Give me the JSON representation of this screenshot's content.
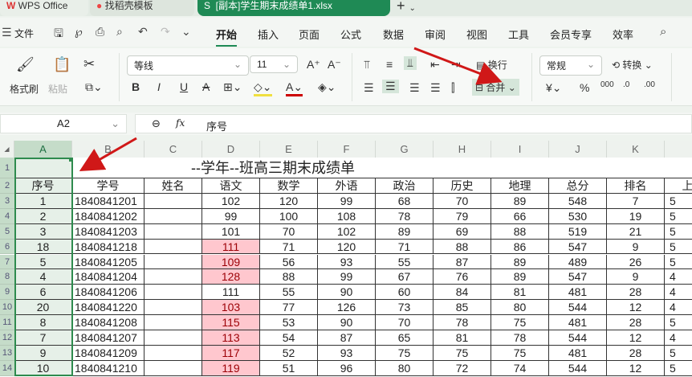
{
  "tabs": [
    {
      "label": "WPS Office"
    },
    {
      "label": "找稻壳模板"
    },
    {
      "label": "[副本]学生期末成绩单1.xlsx"
    }
  ],
  "menu": {
    "file": "文件",
    "items": [
      "开始",
      "插入",
      "页面",
      "公式",
      "数据",
      "审阅",
      "视图",
      "工具",
      "会员专享",
      "效率"
    ],
    "active": "开始"
  },
  "ribbon": {
    "format_painter": "格式刷",
    "paste": "粘贴",
    "font": "等线",
    "size": "11",
    "wrap": "换行",
    "merge": "合并",
    "number_format": "常规",
    "convert": "转换"
  },
  "formula": {
    "cell_ref": "A2",
    "value": "序号"
  },
  "columns": [
    "A",
    "B",
    "C",
    "D",
    "E",
    "F",
    "G",
    "H",
    "I",
    "J",
    "K"
  ],
  "rows": [
    "1",
    "2",
    "3",
    "4",
    "5",
    "6",
    "7",
    "8",
    "9",
    "10",
    "11",
    "12",
    "13",
    "14"
  ],
  "sheet": {
    "title": "--学年--班高三期末成绩单",
    "headers": [
      "序号",
      "学号",
      "姓名",
      "语文",
      "数学",
      "外语",
      "政治",
      "历史",
      "地理",
      "总分",
      "排名",
      "上次"
    ],
    "data": [
      [
        "1",
        "1840841201",
        "",
        "102",
        "120",
        "99",
        "68",
        "70",
        "89",
        "548",
        "7",
        "5"
      ],
      [
        "2",
        "1840841202",
        "",
        "99",
        "100",
        "108",
        "78",
        "79",
        "66",
        "530",
        "19",
        "5"
      ],
      [
        "3",
        "1840841203",
        "",
        "101",
        "70",
        "102",
        "89",
        "69",
        "88",
        "519",
        "21",
        "5"
      ],
      [
        "18",
        "1840841218",
        "",
        "111",
        "71",
        "120",
        "71",
        "88",
        "86",
        "547",
        "9",
        "5"
      ],
      [
        "5",
        "1840841205",
        "",
        "109",
        "56",
        "93",
        "55",
        "87",
        "89",
        "489",
        "26",
        "5"
      ],
      [
        "4",
        "1840841204",
        "",
        "128",
        "88",
        "99",
        "67",
        "76",
        "89",
        "547",
        "9",
        "4"
      ],
      [
        "6",
        "1840841206",
        "",
        "111",
        "55",
        "90",
        "60",
        "84",
        "81",
        "481",
        "28",
        "4"
      ],
      [
        "20",
        "1840841220",
        "",
        "103",
        "77",
        "126",
        "73",
        "85",
        "80",
        "544",
        "12",
        "4"
      ],
      [
        "8",
        "1840841208",
        "",
        "115",
        "53",
        "90",
        "70",
        "78",
        "75",
        "481",
        "28",
        "5"
      ],
      [
        "7",
        "1840841207",
        "",
        "113",
        "54",
        "87",
        "65",
        "81",
        "78",
        "544",
        "12",
        "4"
      ],
      [
        "9",
        "1840841209",
        "",
        "117",
        "52",
        "93",
        "75",
        "75",
        "75",
        "481",
        "28",
        "5"
      ],
      [
        "10",
        "1840841210",
        "",
        "119",
        "51",
        "96",
        "80",
        "72",
        "74",
        "544",
        "12",
        "5"
      ]
    ],
    "highlight_color": "#ffc7ce"
  }
}
